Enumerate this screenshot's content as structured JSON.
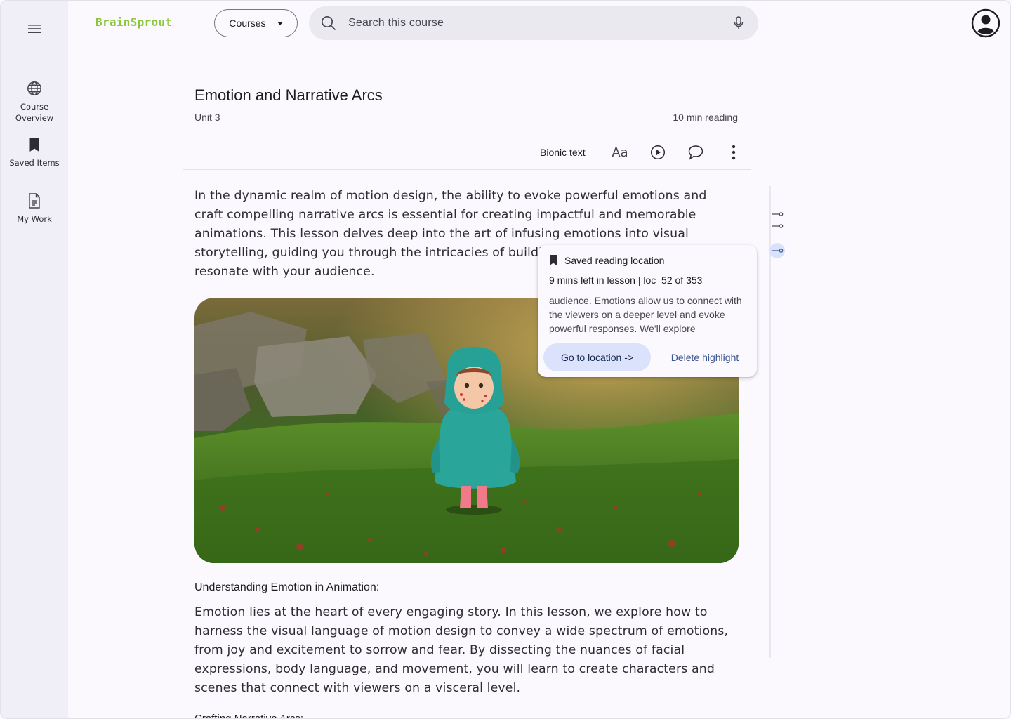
{
  "app": {
    "logo": "BrainSprout",
    "logo_color": "#8cc63f",
    "accent_color": "#dae2fc"
  },
  "header": {
    "courses_label": "Courses",
    "search_placeholder": "Search this course",
    "icons": [
      "menu-icon",
      "search-icon",
      "mic-icon",
      "account-icon"
    ]
  },
  "rail": {
    "items": [
      {
        "label": "Course Overview",
        "icon": "globe-icon"
      },
      {
        "label": "Saved Items",
        "icon": "bookmark-icon"
      },
      {
        "label": "My Work",
        "icon": "document-icon"
      }
    ]
  },
  "lesson": {
    "title": "Emotion and Narrative Arcs",
    "unit": "Unit 3",
    "reading_time": "10 min reading",
    "toolbar": {
      "bionic_label": "Bionic text",
      "font_label": "Aa",
      "icons": [
        "play-icon",
        "comment-icon",
        "more-vert-icon"
      ]
    },
    "intro": "In the dynamic realm of motion design, the ability to evoke powerful emotions and craft compelling narrative arcs is essential for creating impactful and memorable animations. This lesson delves deep into the art of infusing emotions into visual storytelling, guiding you through the intricacies of building narrative structures that resonate with your audience.",
    "section_heading": "Understanding Emotion in Animation:",
    "section_body": "Emotion lies at the heart of every engaging story. In this lesson, we explore how to harness the visual language of motion design to convey a wide spectrum of emotions, from joy and excitement to sorrow and fear. By dissecting the nuances of facial expressions, body language, and movement, you will learn to create characters and scenes that connect with viewers on a visceral level.",
    "next_heading_partial": "Crafting Narrative Arcs:"
  },
  "popover": {
    "title": "Saved reading location",
    "meta": "9 mins left in lesson | loc  52 of 353",
    "excerpt": "audience. Emotions allow us to connect with the viewers on a deeper level and evoke powerful responses. We'll explore",
    "go_label": "Go to location ->",
    "delete_label": "Delete highlight"
  }
}
